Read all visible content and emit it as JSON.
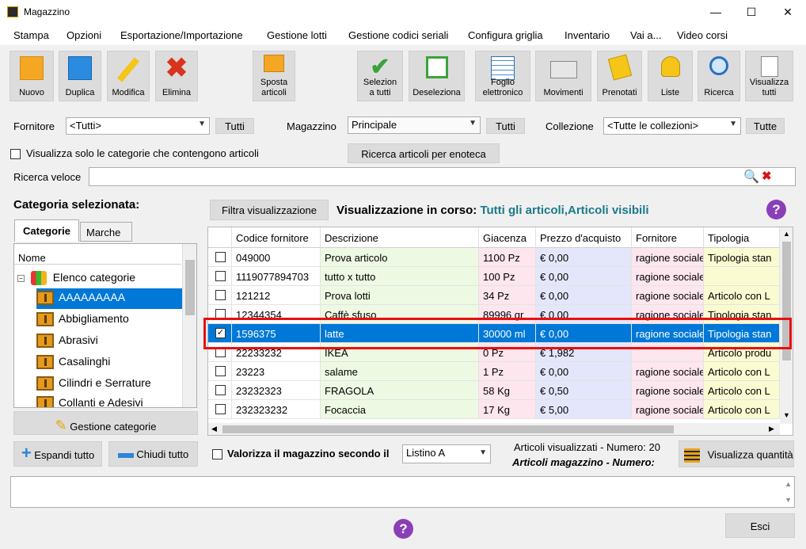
{
  "window": {
    "title": "Magazzino",
    "minimize": "—",
    "maximize": "☐",
    "close": "✕"
  },
  "menu": [
    "Stampa",
    "Opzioni",
    "Esportazione/Importazione",
    "Gestione lotti",
    "Gestione codici seriali",
    "Configura griglia",
    "Inventario",
    "Vai a...",
    "Video corsi"
  ],
  "toolbar": {
    "nuovo": "Nuovo",
    "duplica": "Duplica",
    "modifica": "Modifica",
    "elimina": "Elimina",
    "sposta1": "Sposta",
    "sposta2": "articoli",
    "selez1": "Selezion",
    "selez2": "a tutti",
    "deseleziona": "Deseleziona",
    "foglio1": "Foglio",
    "foglio2": "elettronico",
    "movimenti": "Movimenti",
    "prenotati": "Prenotati",
    "liste": "Liste",
    "ricerca": "Ricerca",
    "vis1": "Visualizza",
    "vis2": "tutti"
  },
  "filters": {
    "fornitore_label": "Fornitore",
    "fornitore_value": "<Tutti>",
    "tutti1": "Tutti",
    "magazzino_label": "Magazzino",
    "magazzino_value": "Principale",
    "tutti2": "Tutti",
    "collezione_label": "Collezione",
    "collezione_value": "<Tutte le collezioni>",
    "tutte": "Tutte",
    "solo_categorie": "Visualizza solo le categorie che contengono articoli",
    "ricerca_enoteca": "Ricerca articoli per enoteca",
    "ricerca_veloce": "Ricerca veloce"
  },
  "left": {
    "categoria_title": "Categoria selezionata:",
    "tab_categorie": "Categorie",
    "tab_marche": "Marche",
    "col_nome": "Nome",
    "root": "Elenco categorie",
    "items": [
      "AAAAAAAAA",
      "Abbigliamento",
      "Abrasivi",
      "Casalinghi",
      "Cilindri e Serrature",
      "Collanti e Adesivi"
    ],
    "gestione_categorie": "Gestione categorie",
    "espandi": "Espandi tutto",
    "chiudi": "Chiudi tutto"
  },
  "view": {
    "filtra": "Filtra visualizzazione",
    "in_corso_label": "Visualizzazione in corso:",
    "in_corso_value": "Tutti gli articoli,Articoli visibili"
  },
  "grid": {
    "headers": [
      "Codice fornitore",
      "Descrizione",
      "Giacenza",
      "Prezzo d'acquisto",
      "Fornitore",
      "Tipologia"
    ],
    "rows": [
      {
        "checked": false,
        "cells": [
          "049000",
          "Prova articolo",
          "1100 Pz",
          "€ 0,00",
          "ragione sociale",
          "Tipologia stan"
        ]
      },
      {
        "checked": false,
        "cells": [
          "1119077894703",
          "tutto x tutto",
          "100 Pz",
          "€ 0,00",
          "ragione sociale",
          ""
        ]
      },
      {
        "checked": false,
        "cells": [
          "121212",
          "Prova lotti",
          "34 Pz",
          "€ 0,00",
          "ragione sociale",
          "Articolo con L"
        ]
      },
      {
        "checked": false,
        "cells": [
          "12344354",
          "Caffè sfuso",
          "89996 gr",
          "€ 0,00",
          "ragione sociale",
          "Tipologia stan"
        ]
      },
      {
        "checked": true,
        "cells": [
          "1596375",
          "latte",
          "30000 ml",
          "€ 0,00",
          "ragione sociale",
          "Tipologia stan"
        ]
      },
      {
        "checked": false,
        "cells": [
          "22233232",
          "IKEA",
          "0 Pz",
          "€ 1,982",
          "",
          "Articolo produ"
        ]
      },
      {
        "checked": false,
        "cells": [
          "23223",
          "salame",
          "1 Pz",
          "€ 0,00",
          "ragione sociale",
          "Articolo con L"
        ]
      },
      {
        "checked": false,
        "cells": [
          "23232323",
          "FRAGOLA",
          "58 Kg",
          "€ 0,50",
          "ragione sociale",
          "Articolo con L"
        ]
      },
      {
        "checked": false,
        "cells": [
          "232323232",
          "Focaccia",
          "17 Kg",
          "€ 5,00",
          "ragione sociale",
          "Articolo con L"
        ]
      }
    ],
    "selected_row": 4
  },
  "bottom": {
    "valorizza": "Valorizza il magazzino secondo il",
    "listino": "Listino A",
    "visualizzati": "Articoli visualizzati - Numero: 20",
    "magazzino_num": "Articoli magazzino - Numero:",
    "visualizza_quantita": "Visualizza quantità",
    "esci": "Esci"
  },
  "colors": {
    "selection": "#0078d7",
    "highlight_frame": "#e81010",
    "teal_text": "#1a7a8a",
    "help_purple": "#8a3fb8"
  }
}
